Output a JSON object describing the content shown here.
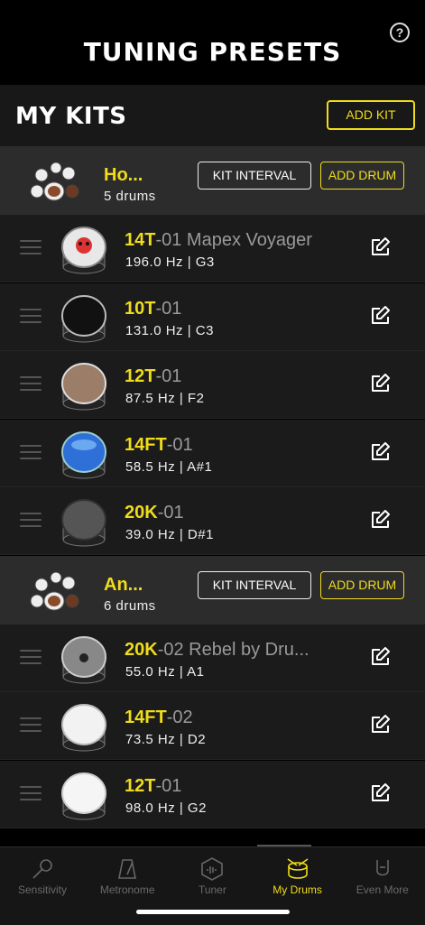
{
  "header": {
    "title": "TUNING PRESETS",
    "help_icon": "?"
  },
  "section": {
    "title": "MY KITS",
    "add_kit_label": "ADD KIT"
  },
  "kits": [
    {
      "name": "Ho...",
      "count": "5 drums",
      "kit_interval_label": "KIT INTERVAL",
      "add_drum_label": "ADD DRUM",
      "drums": [
        {
          "code": "14T",
          "rest": "-01 Mapex Voyager",
          "freq": "196.0 Hz | G3",
          "style": "skull"
        },
        {
          "code": "10T",
          "rest": "-01",
          "freq": "131.0 Hz | C3",
          "style": "black"
        },
        {
          "code": "12T",
          "rest": "-01",
          "freq": "87.5 Hz | F2",
          "style": "clear"
        },
        {
          "code": "14FT",
          "rest": "-01",
          "freq": "58.5 Hz | A#1",
          "style": "blue"
        },
        {
          "code": "20K",
          "rest": "-01",
          "freq": "39.0 Hz | D#1",
          "style": "kick"
        }
      ]
    },
    {
      "name": "An...",
      "count": "6 drums",
      "kit_interval_label": "KIT INTERVAL",
      "add_drum_label": "ADD DRUM",
      "drums": [
        {
          "code": "20K",
          "rest": "-02 Rebel by Dru...",
          "freq": "55.0 Hz | A1",
          "style": "kick2"
        },
        {
          "code": "14FT",
          "rest": "-02",
          "freq": "73.5 Hz | D2",
          "style": "white"
        },
        {
          "code": "12T",
          "rest": "-01",
          "freq": "98.0 Hz | G2",
          "style": "white2"
        }
      ]
    }
  ],
  "tabs": [
    {
      "label": "Sensitivity",
      "icon": "microphone-icon",
      "active": false
    },
    {
      "label": "Metronome",
      "icon": "metronome-icon",
      "active": false
    },
    {
      "label": "Tuner",
      "icon": "tuner-icon",
      "active": false
    },
    {
      "label": "My Drums",
      "icon": "drum-icon",
      "active": true
    },
    {
      "label": "Even More",
      "icon": "rock-hand-icon",
      "active": false
    }
  ],
  "colors": {
    "accent": "#f0dc1a",
    "background": "#000000",
    "kit_row": "#2c2c2c",
    "drum_row": "#1b1b1b"
  }
}
